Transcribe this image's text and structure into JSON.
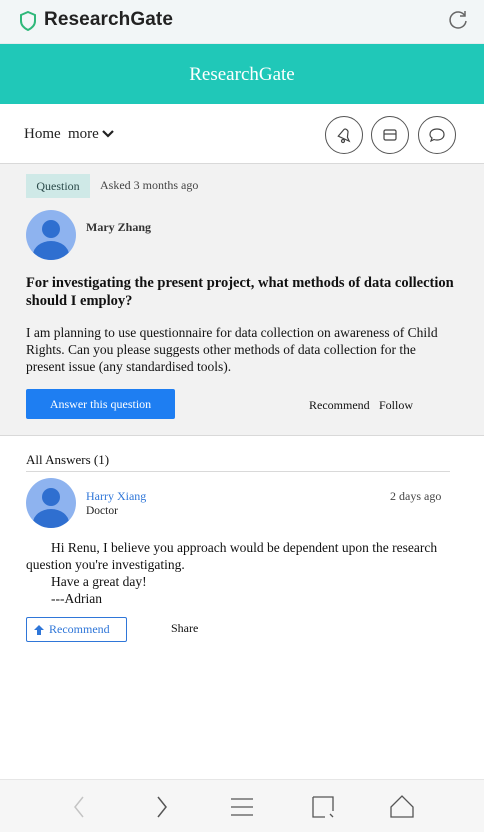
{
  "browser": {
    "app_title": "ResearchGate"
  },
  "header": {
    "title": "ResearchGate"
  },
  "nav": {
    "home": "Home",
    "more": "more"
  },
  "question": {
    "badge": "Question",
    "asked": "Asked 3 months ago",
    "author": "Mary Zhang",
    "title": "For investigating the present project, what methods of data collection should I employ?",
    "body": "I am planning to use questionnaire for data collection on awareness of Child Rights. Can you please suggests other methods of data collection for the present issue (any standardised tools).",
    "answer_button": "Answer this question",
    "recommend": "Recommend",
    "follow": "Follow"
  },
  "answers": {
    "title": "All Answers (1)",
    "items": [
      {
        "author": "Harry Xiang",
        "role": "Doctor",
        "date": "2 days ago",
        "line1": "Hi Renu, I believe you approach would be dependent upon the research",
        "line2": "question you're investigating.",
        "line3": "Have a great day!",
        "line4": "---Adrian",
        "recommend": "Recommend",
        "share": "Share"
      }
    ]
  },
  "colors": {
    "header_bg": "#20c8b8",
    "accent_blue": "#1e7ef2",
    "link_blue": "#2f76d8",
    "badge_bg": "#cfe9e7"
  },
  "icons": [
    "shield-icon",
    "reload-icon",
    "chevron-down-icon",
    "bell-icon",
    "mail-icon",
    "chat-icon",
    "arrow-up-icon",
    "back-icon",
    "forward-icon",
    "menu-icon",
    "tabs-icon",
    "home-icon"
  ]
}
